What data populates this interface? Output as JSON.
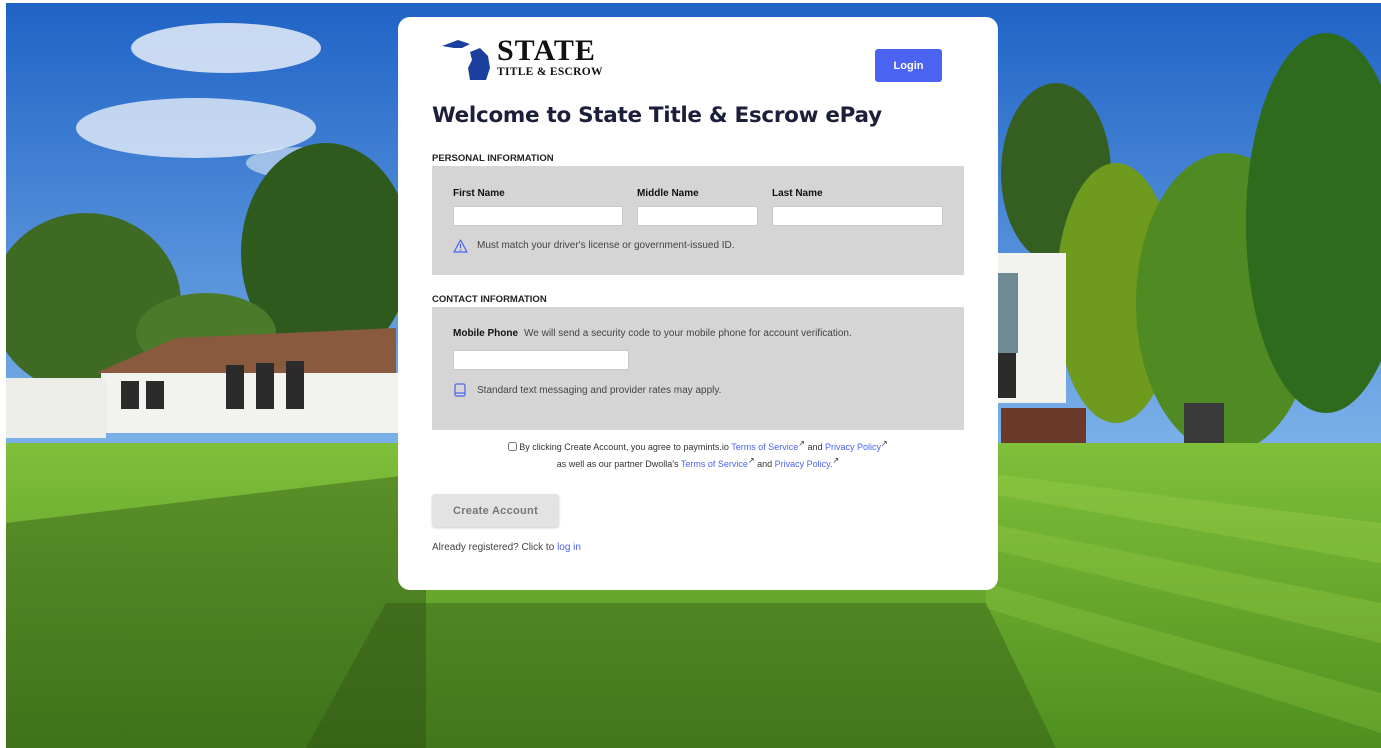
{
  "logo": {
    "brand_top": "STATE",
    "brand_sub": "TITLE & ESCROW"
  },
  "header": {
    "login_label": "Login",
    "title": "Welcome to State Title & Escrow ePay"
  },
  "personal": {
    "section_label": "PERSONAL INFORMATION",
    "first_name_label": "First Name",
    "first_name_value": "",
    "middle_name_label": "Middle Name",
    "middle_name_value": "",
    "last_name_label": "Last Name",
    "last_name_value": "",
    "id_hint": "Must match your driver's license or government-issued ID.",
    "hint_icon": "warning-triangle-icon"
  },
  "contact": {
    "section_label": "CONTACT INFORMATION",
    "mobile_label": "Mobile Phone",
    "mobile_note": "We will send a security code to your mobile phone for account verification.",
    "mobile_value": "",
    "rates_hint": "Standard text messaging and provider rates may apply.",
    "hint_icon": "mobile-phone-icon"
  },
  "agreement": {
    "checked": false,
    "text_1": "By clicking Create Account, you agree to paymints.io",
    "terms_1": "Terms of Service",
    "and_1": "and",
    "privacy_1": "Privacy Policy",
    "text_2": "as well as our partner Dwolla's",
    "terms_2": "Terms of Service",
    "and_2": "and",
    "privacy_2": "Privacy Policy.",
    "external_icon": "external-link-icon"
  },
  "actions": {
    "create_account_label": "Create Account",
    "already_text": "Already registered? Click to",
    "login_link": "log in"
  },
  "colors": {
    "accent": "#4a63f0",
    "panel_bg": "#d5d5d5",
    "title": "#1b1f3a"
  }
}
